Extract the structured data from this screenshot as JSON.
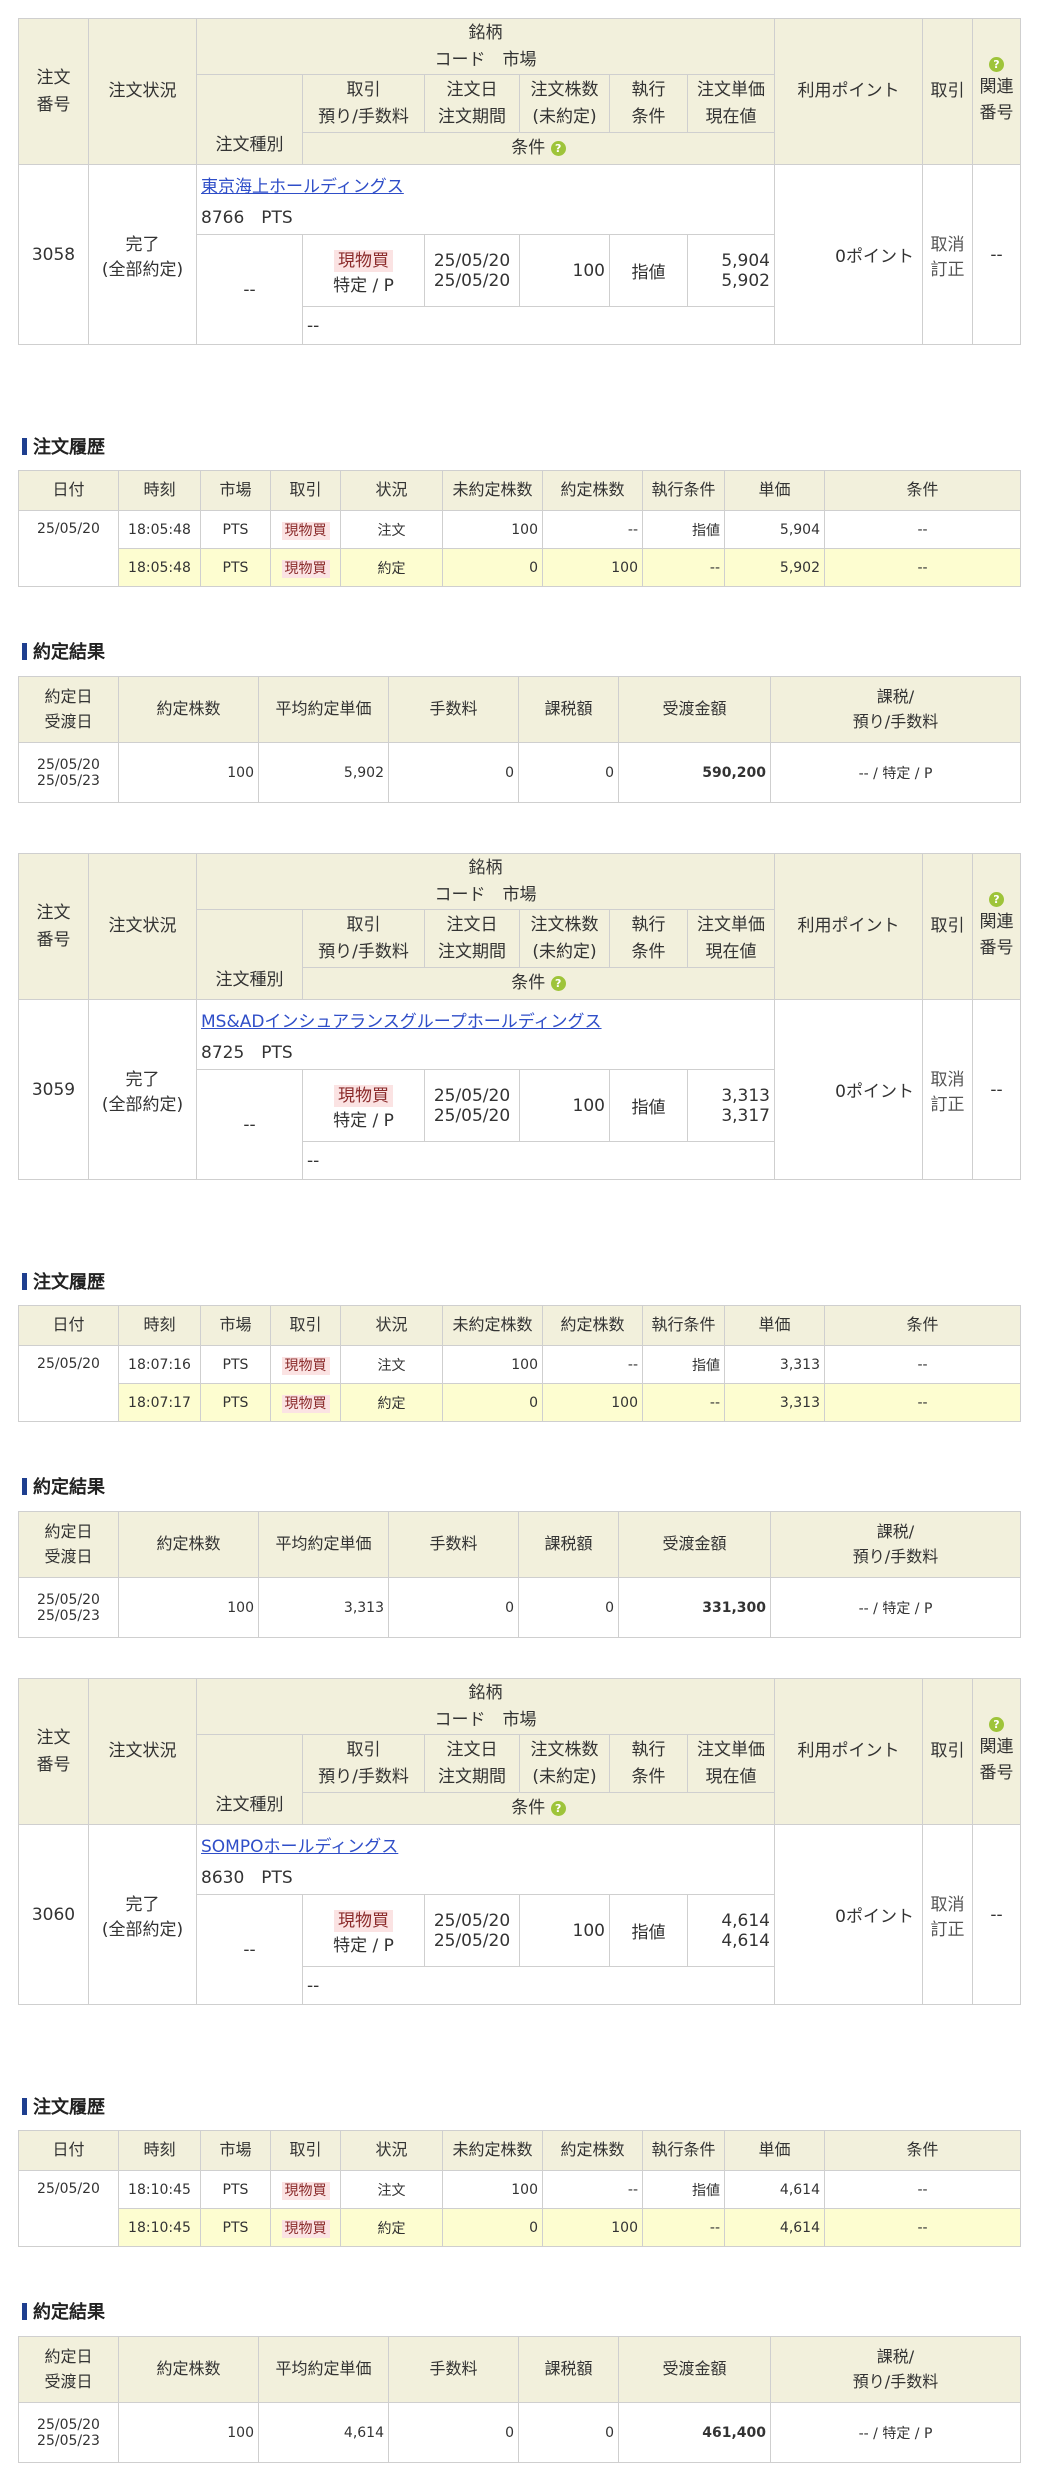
{
  "order_header": {
    "order_no": "注文\n番号",
    "status": "注文状況",
    "stock": "銘柄",
    "code_market": "コード　市場",
    "order_type": "注文種別",
    "trade_fee": "取引\n預り/手数料",
    "date_period": "注文日\n注文期間",
    "qty": "注文株数\n(未約定)",
    "exec_cond": "執行\n条件",
    "unit_price": "注文単価\n現在値",
    "condition": "条件",
    "points": "利用ポイント",
    "trade": "取引",
    "related": "関連\n番号"
  },
  "history_header": [
    "日付",
    "時刻",
    "市場",
    "取引",
    "状況",
    "未約定株数",
    "約定株数",
    "執行条件",
    "単価",
    "条件"
  ],
  "result_header": [
    "約定日\n受渡日",
    "約定株数",
    "平均約定単価",
    "手数料",
    "課税額",
    "受渡金額",
    "課税/\n預り/手数料"
  ],
  "labels": {
    "history_title": "注文履歴",
    "result_title": "約定結果",
    "cancel": "取消",
    "modify": "訂正"
  },
  "orders": [
    {
      "order_no": "3058",
      "status": "完了\n(全部約定)",
      "stock_name": "東京海上ホールディングス",
      "code_market": "8766　PTS",
      "order_type": "--",
      "trade": "現物買",
      "account": "特定 / P",
      "order_date": "25/05/20",
      "period": "25/05/20",
      "qty": "100",
      "exec_cond": "指値",
      "order_price": "5,904",
      "current_price": "5,902",
      "condition": "--",
      "points": "0ポイント",
      "related": "--",
      "history": [
        {
          "date": "25/05/20",
          "time": "18:05:48",
          "market": "PTS",
          "trade": "現物買",
          "status": "注文",
          "unfilled": "100",
          "filled": "--",
          "exec": "指値",
          "price": "5,904",
          "cond": "--"
        },
        {
          "date": "",
          "time": "18:05:48",
          "market": "PTS",
          "trade": "現物買",
          "status": "約定",
          "unfilled": "0",
          "filled": "100",
          "exec": "--",
          "price": "5,902",
          "cond": "--"
        }
      ],
      "result": {
        "exec_date": "25/05/20",
        "settle_date": "25/05/23",
        "qty": "100",
        "avg_price": "5,902",
        "fee": "0",
        "tax": "0",
        "amount": "590,200",
        "account": "-- / 特定 / P"
      }
    },
    {
      "order_no": "3059",
      "status": "完了\n(全部約定)",
      "stock_name": "MS&ADインシュアランスグループホールディングス",
      "code_market": "8725　PTS",
      "order_type": "--",
      "trade": "現物買",
      "account": "特定 / P",
      "order_date": "25/05/20",
      "period": "25/05/20",
      "qty": "100",
      "exec_cond": "指値",
      "order_price": "3,313",
      "current_price": "3,317",
      "condition": "--",
      "points": "0ポイント",
      "related": "--",
      "history": [
        {
          "date": "25/05/20",
          "time": "18:07:16",
          "market": "PTS",
          "trade": "現物買",
          "status": "注文",
          "unfilled": "100",
          "filled": "--",
          "exec": "指値",
          "price": "3,313",
          "cond": "--"
        },
        {
          "date": "",
          "time": "18:07:17",
          "market": "PTS",
          "trade": "現物買",
          "status": "約定",
          "unfilled": "0",
          "filled": "100",
          "exec": "--",
          "price": "3,313",
          "cond": "--"
        }
      ],
      "result": {
        "exec_date": "25/05/20",
        "settle_date": "25/05/23",
        "qty": "100",
        "avg_price": "3,313",
        "fee": "0",
        "tax": "0",
        "amount": "331,300",
        "account": "-- / 特定 / P"
      }
    },
    {
      "order_no": "3060",
      "status": "完了\n(全部約定)",
      "stock_name": "SOMPOホールディングス",
      "code_market": "8630　PTS",
      "order_type": "--",
      "trade": "現物買",
      "account": "特定 / P",
      "order_date": "25/05/20",
      "period": "25/05/20",
      "qty": "100",
      "exec_cond": "指値",
      "order_price": "4,614",
      "current_price": "4,614",
      "condition": "--",
      "points": "0ポイント",
      "related": "--",
      "history": [
        {
          "date": "25/05/20",
          "time": "18:10:45",
          "market": "PTS",
          "trade": "現物買",
          "status": "注文",
          "unfilled": "100",
          "filled": "--",
          "exec": "指値",
          "price": "4,614",
          "cond": "--"
        },
        {
          "date": "",
          "time": "18:10:45",
          "market": "PTS",
          "trade": "現物買",
          "status": "約定",
          "unfilled": "0",
          "filled": "100",
          "exec": "--",
          "price": "4,614",
          "cond": "--"
        }
      ],
      "result": {
        "exec_date": "25/05/20",
        "settle_date": "25/05/23",
        "qty": "100",
        "avg_price": "4,614",
        "fee": "0",
        "tax": "0",
        "amount": "461,400",
        "account": "-- / 特定 / P"
      }
    }
  ]
}
